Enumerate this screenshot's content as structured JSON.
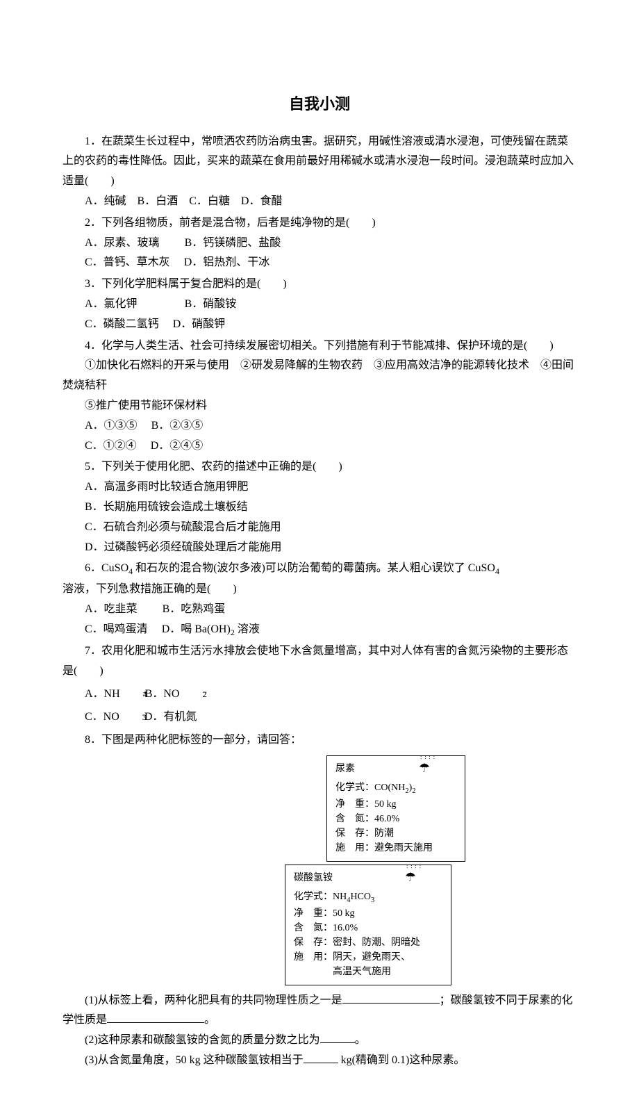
{
  "title": "自我小测",
  "q1": {
    "stem": "1．在蔬菜生长过程中，常喷洒农药防治病虫害。据研究，用碱性溶液或清水浸泡，可使残留在蔬菜上的农药的毒性降低。因此，买来的蔬菜在食用前最好用稀碱水或清水浸泡一段时间。浸泡蔬菜时应加入适量(　　)",
    "opts": "A．纯碱　B．白酒　C．白糖　D．食醋"
  },
  "q2": {
    "stem": "2．下列各组物质，前者是混合物，后者是纯净物的是(　　)",
    "opt_a": "A．尿素、玻璃",
    "opt_b": "B．钙镁磷肥、盐酸",
    "opt_c": "C．普钙、草木灰",
    "opt_d": "D．铝热剂、干冰"
  },
  "q3": {
    "stem": "3．下列化学肥料属于复合肥料的是(　　)",
    "opt_a": "A．氯化钾",
    "opt_b": "B．硝酸铵",
    "opt_c": "C．磷酸二氢钙",
    "opt_d": "D．硝酸钾"
  },
  "q4": {
    "stem": "4．化学与人类生活、社会可持续发展密切相关。下列措施有利于节能减排、保护环境的是(　　)",
    "items": "①加快化石燃料的开采与使用　②研发易降解的生物农药　③应用高效洁净的能源转化技术　④田间焚烧秸秆",
    "item5": "⑤推广使用节能环保材料",
    "opt_a": "A．①③⑤",
    "opt_b": "B．②③⑤",
    "opt_c": "C．①②④",
    "opt_d": "D．②④⑤"
  },
  "q5": {
    "stem": "5．下列关于使用化肥、农药的描述中正确的是(　　)",
    "opt_a": "A．高温多雨时比较适合施用钾肥",
    "opt_b": "B．长期施用硫铵会造成土壤板结",
    "opt_c": "C．石硫合剂必须与硫酸混合后才能施用",
    "opt_d": "D．过磷酸钙必须经硫酸处理后才能施用"
  },
  "q6": {
    "stem_a": "6．CuSO",
    "stem_b": " 和石灰的混合物(波尔多液)可以防治葡萄的霉菌病。某人粗心误饮了 CuSO",
    "stem_c": "溶液，下列急救措施正确的是(　　)",
    "opt_a": "A．吃韭菜",
    "opt_b": "B．吃熟鸡蛋",
    "opt_c": "C．喝鸡蛋清",
    "opt_d_pre": "D．喝 Ba(OH)",
    "opt_d_post": " 溶液"
  },
  "q7": {
    "stem": "7．农用化肥和城市生活污水排放会使地下水含氮量增高，其中对人体有害的含氮污染物的主要形态是(　　)",
    "opt_a_pre": "A．NH",
    "opt_b_pre": "B．NO",
    "opt_c_pre": "C．NO",
    "opt_d": "D．有机氮"
  },
  "q8": {
    "stem": "8．下图是两种化肥标签的一部分，请回答：",
    "label1": {
      "name": "尿素",
      "formula_pre": "化学式：CO(NH",
      "formula_post": ")",
      "weight": "净　重：50 kg",
      "nitrogen": "含　氮：46.0%",
      "storage": "保　存：防潮",
      "usage": "施　用：避免雨天施用"
    },
    "label2": {
      "name": "碳酸氢铵",
      "formula_pre": "化学式：NH",
      "formula_mid": "HCO",
      "weight": "净　重：50 kg",
      "nitrogen": "含　氮：16.0%",
      "storage": "保　存：密封、防潮、阴暗处",
      "usage1": "施　用：阴天，避免雨天、",
      "usage2": "　　　　高温天气施用"
    },
    "sub1_a": "(1)从标签上看，两种化肥具有的共同物理性质之一是",
    "sub1_b": "；碳酸氢铵不同于尿素的化学性质是",
    "sub1_c": "。",
    "sub2_a": "(2)这种尿素和碳酸氢铵的含氮的质量分数之比为",
    "sub2_b": "。",
    "sub3_a": "(3)从含氮量角度，50 kg 这种碳酸氢铵相当于",
    "sub3_b": " kg(精确到 0.1)这种尿素。"
  }
}
